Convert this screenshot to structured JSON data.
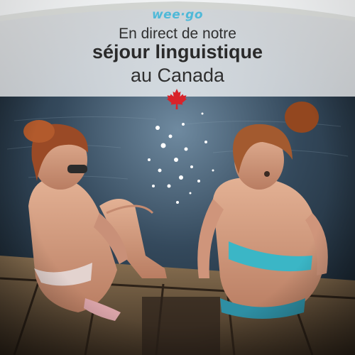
{
  "brand": {
    "logo_text": "wee·go",
    "color": "#4fb9d8"
  },
  "headline": {
    "line1": "En direct de notre",
    "line2": "séjour linguistique",
    "line3": "au Canada"
  },
  "icons": {
    "flag": "maple-leaf-icon",
    "flag_color": "#d8232a"
  },
  "photo": {
    "subject": "two-girls-sitting-on-dock-over-lake"
  }
}
